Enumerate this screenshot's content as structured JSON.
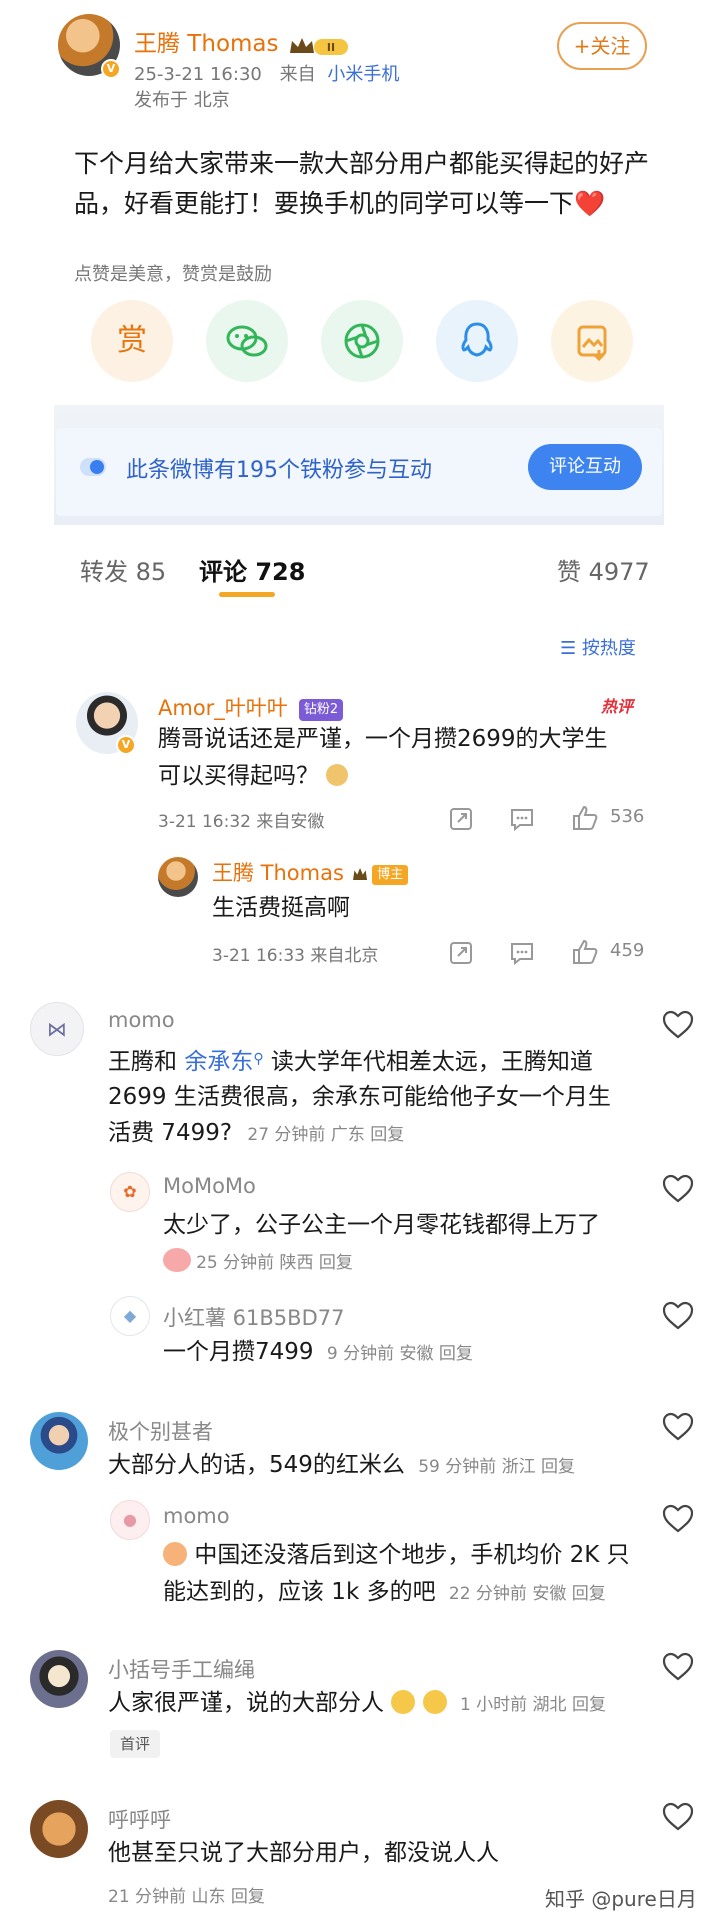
{
  "post": {
    "author": "王腾 Thomas",
    "level_badge": "II",
    "time": "25-3-21 16:30",
    "source_prefix": "来自",
    "source_device": "小米手机",
    "location": "发布于 北京",
    "follow_label": "+关注",
    "text": "下个月给大家带来一款大部分用户都能买得起的好产品，好看更能打！要换手机的同学可以等一下❤️",
    "reward_hint": "点赞是美意，赞赏是鼓励",
    "share_buttons": [
      {
        "name": "reward",
        "label": "赏"
      },
      {
        "name": "wechat",
        "label": ""
      },
      {
        "name": "moments",
        "label": ""
      },
      {
        "name": "qq",
        "label": ""
      },
      {
        "name": "save-image",
        "label": ""
      }
    ],
    "fans_text": "此条微博有195个铁粉参与互动",
    "fans_button": "评论互动"
  },
  "tabs": {
    "repost": "转发 85",
    "comment": "评论 728",
    "like": "赞 4977"
  },
  "sort_label": "按热度",
  "comments": {
    "c1": {
      "name": "Amor_叶叶叶",
      "badge": "钻粉2",
      "hot": "热评",
      "text_line1": "腾哥说话还是严谨，一个月攒2699的大学生",
      "text_line2": "可以买得起吗？",
      "time": "3-21 16:32  来自安徽",
      "likes": "536"
    },
    "c1_reply": {
      "name": "王腾 Thomas",
      "badge": "博主",
      "text": "生活费挺高啊",
      "time": "3-21 16:33  来自北京",
      "likes": "459"
    },
    "c2": {
      "name": "momo",
      "text_line1_a": "王腾和 ",
      "text_line1_link": "余承东",
      "text_line1_b": " 读大学年代相差太远，王腾知道",
      "text_line2": "2699 生活费很高，余承东可能给他子女一个月生",
      "text_line3": "活费 7499?",
      "meta": "27 分钟前  广东  回复"
    },
    "c2_r1": {
      "name": "MoMoMo",
      "text": "太少了，公子公主一个月零花钱都得上万了",
      "meta": "25 分钟前  陕西  回复"
    },
    "c2_r2": {
      "name": "小红薯 61B5BD77",
      "text": "一个月攒7499",
      "meta": "9 分钟前  安徽  回复"
    },
    "c3": {
      "name": "极个别甚者",
      "text": "大部分人的话，549的红米么",
      "meta": "59 分钟前  浙江  回复"
    },
    "c3_r1": {
      "name": "momo",
      "text_line1": "中国还没落后到这个地步，手机均价 2K 只",
      "text_line2": "能达到的，应该 1k 多的吧",
      "meta": "22 分钟前  安徽  回复"
    },
    "c4": {
      "name": "小括号手工编绳",
      "text": "人家很严谨，说的大部分人",
      "meta": "1 小时前  湖北  回复",
      "tag": "首评"
    },
    "c5": {
      "name": "呼呼呼",
      "text": "他甚至只说了大部分用户，都没说人人",
      "meta": "21 分钟前  山东  回复"
    }
  },
  "watermark": "知乎 @pure日月",
  "colors": {
    "orange": "#e8710a",
    "blue": "#3a6fd8",
    "gold": "#f5a623"
  }
}
